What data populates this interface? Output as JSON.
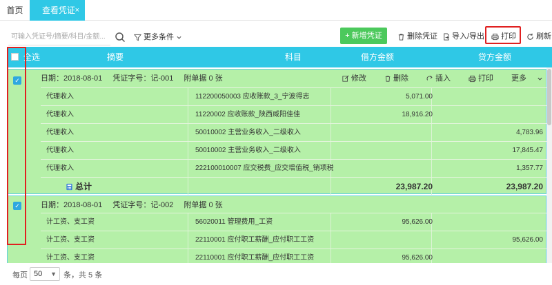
{
  "tabs": {
    "home": "首页",
    "active": "查看凭证",
    "close_glyph": "×"
  },
  "toolbar": {
    "search_placeholder": "可输入凭证号/摘要/科目/金额...",
    "filter_label": "更多条件",
    "add_label": "+ 新增凭证",
    "delete_label": "删除凭证",
    "import_export_label": "导入/导出",
    "print_label": "打印",
    "refresh_label": "刷新"
  },
  "table": {
    "headers": {
      "select_all": "全选",
      "summary": "摘要",
      "subject": "科目",
      "debit": "借方金额",
      "credit": "贷方金额"
    }
  },
  "vouchers": [
    {
      "checked": true,
      "date_label": "日期：2018-08-01",
      "number_label": "凭证字号：记-001",
      "attachments_label": "附单据 0 张",
      "actions": {
        "edit": "修改",
        "delete": "删除",
        "insert": "插入",
        "print": "打印",
        "more": "更多"
      },
      "rows": [
        {
          "summary": "代理收入",
          "subject": "112200050003 应收账款_3_宁波得志",
          "debit": "5,071.00",
          "credit": ""
        },
        {
          "summary": "代理收入",
          "subject": "11220002 应收账款_陕西威阳佳佳",
          "debit": "18,916.20",
          "credit": ""
        },
        {
          "summary": "代理收入",
          "subject": "50010002 主营业务收入_二级收入",
          "debit": "",
          "credit": "4,783.96"
        },
        {
          "summary": "代理收入",
          "subject": "50010002 主营业务收入_二级收入",
          "debit": "",
          "credit": "17,845.47"
        },
        {
          "summary": "代理收入",
          "subject": "222100010007 应交税费_应交增值税_销项税额",
          "debit": "",
          "credit": "1,357.77"
        }
      ],
      "total": {
        "label": "总计",
        "debit": "23,987.20",
        "credit": "23,987.20"
      }
    },
    {
      "checked": true,
      "date_label": "日期：2018-08-01",
      "number_label": "凭证字号：记-002",
      "attachments_label": "附单据 0 张",
      "rows": [
        {
          "summary": "计工资、支工资",
          "subject": "56020011 管理费用_工资",
          "debit": "95,626.00",
          "credit": ""
        },
        {
          "summary": "计工资、支工资",
          "subject": "22110001 应付职工薪酬_应付职工工资",
          "debit": "",
          "credit": "95,626.00"
        },
        {
          "summary": "计工资、支工资",
          "subject": "22110001 应付职工薪酬_应付职工工资",
          "debit": "95,626.00",
          "credit": ""
        }
      ]
    }
  ],
  "footer": {
    "per_page_label": "每页",
    "per_page_value": "50",
    "total_label": "条，共 5 条"
  },
  "colors": {
    "accent": "#2fc8e6",
    "row_highlight": "#b5f0a8",
    "add_button": "#4cc95c",
    "annotation_red": "#e02020"
  }
}
